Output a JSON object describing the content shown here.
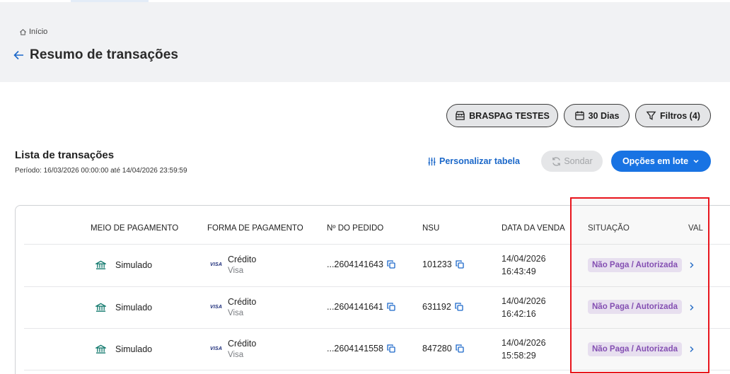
{
  "header": {
    "breadcrumb": "Início",
    "title": "Resumo de transações"
  },
  "filters": {
    "merchant": "BRASPAG TESTES",
    "period": "30 Dias",
    "filters": "Filtros (4)"
  },
  "section": {
    "title": "Lista de transações",
    "period": "Período: 16/03/2026 00:00:00 até 14/04/2026 23:59:59"
  },
  "actions": {
    "customize": "Personalizar tabela",
    "sondar": "Sondar",
    "batch": "Opções em lote"
  },
  "table": {
    "columns": [
      "MEIO DE PAGAMENTO",
      "FORMA DE PAGAMENTO",
      "Nº DO PEDIDO",
      "NSU",
      "DATA DA VENDA",
      "SITUAÇÃO",
      "VAL"
    ],
    "rows": [
      {
        "method": "Simulado",
        "form": "Crédito",
        "brand": "Visa",
        "brand_logo": "VISA",
        "order": "...2604141643",
        "nsu": "101233",
        "date": "14/04/2026",
        "time": "16:43:49",
        "status": "Não Paga / Autorizada"
      },
      {
        "method": "Simulado",
        "form": "Crédito",
        "brand": "Visa",
        "brand_logo": "VISA",
        "order": "...2604141641",
        "nsu": "631192",
        "date": "14/04/2026",
        "time": "16:42:16",
        "status": "Não Paga / Autorizada"
      },
      {
        "method": "Simulado",
        "form": "Crédito",
        "brand": "Visa",
        "brand_logo": "VISA",
        "order": "...2604141558",
        "nsu": "847280",
        "date": "14/04/2026",
        "time": "15:58:29",
        "status": "Não Paga / Autorizada"
      }
    ]
  },
  "colors": {
    "primary": "#1873e3",
    "link": "#1a67c9",
    "status_bg": "#ece3f5",
    "status_text": "#7b3fb0",
    "highlight": "#e8141c",
    "icon_teal": "#137a6e"
  }
}
